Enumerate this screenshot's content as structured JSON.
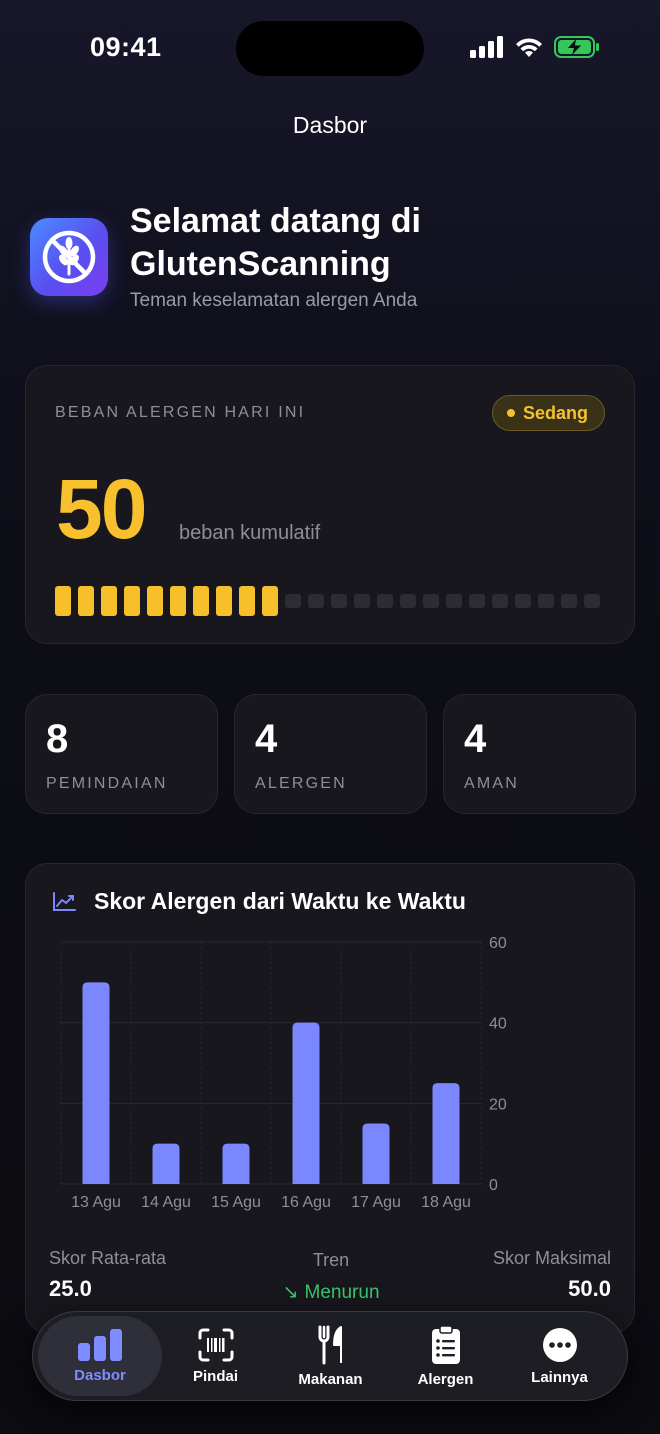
{
  "status_bar": {
    "time": "09:41"
  },
  "nav": {
    "title": "Dasbor"
  },
  "welcome": {
    "title": "Selamat datang di GlutenScanning",
    "subtitle": "Teman keselamatan alergen Anda"
  },
  "allergen_load": {
    "label": "BEBAN ALERGEN HARI INI",
    "badge": "Sedang",
    "value": "50",
    "unit": "beban kumulatif",
    "segments_total": 24,
    "segments_filled": 10,
    "accent_color": "#f7c02c"
  },
  "stats": [
    {
      "value": "8",
      "label": "PEMINDAIAN"
    },
    {
      "value": "4",
      "label": "ALERGEN"
    },
    {
      "value": "4",
      "label": "AMAN"
    }
  ],
  "chart": {
    "title": "Skor Alergen dari Waktu ke Waktu",
    "icon": "chart-line-icon",
    "bar_color": "#7b87ff"
  },
  "chart_data": {
    "type": "bar",
    "categories": [
      "13 Agu",
      "14 Agu",
      "15 Agu",
      "16 Agu",
      "17 Agu",
      "18 Agu"
    ],
    "values": [
      50,
      10,
      10,
      40,
      15,
      25
    ],
    "yticks": [
      "0",
      "20",
      "40",
      "60"
    ],
    "ylim": [
      0,
      60
    ],
    "grid": true,
    "y_axis_side": "right"
  },
  "metrics": {
    "avg_label": "Skor Rata-rata",
    "avg_value": "25.0",
    "trend_label": "Tren",
    "trend_value": "Menurun",
    "max_label": "Skor Maksimal",
    "max_value": "50.0"
  },
  "tabs": [
    {
      "label": "Dasbor",
      "icon": "bar-chart-icon",
      "active": true
    },
    {
      "label": "Pindai",
      "icon": "barcode-scan-icon"
    },
    {
      "label": "Makanan",
      "icon": "fork-knife-icon"
    },
    {
      "label": "Alergen",
      "icon": "clipboard-list-icon"
    },
    {
      "label": "Lainnya",
      "icon": "more-icon"
    }
  ]
}
